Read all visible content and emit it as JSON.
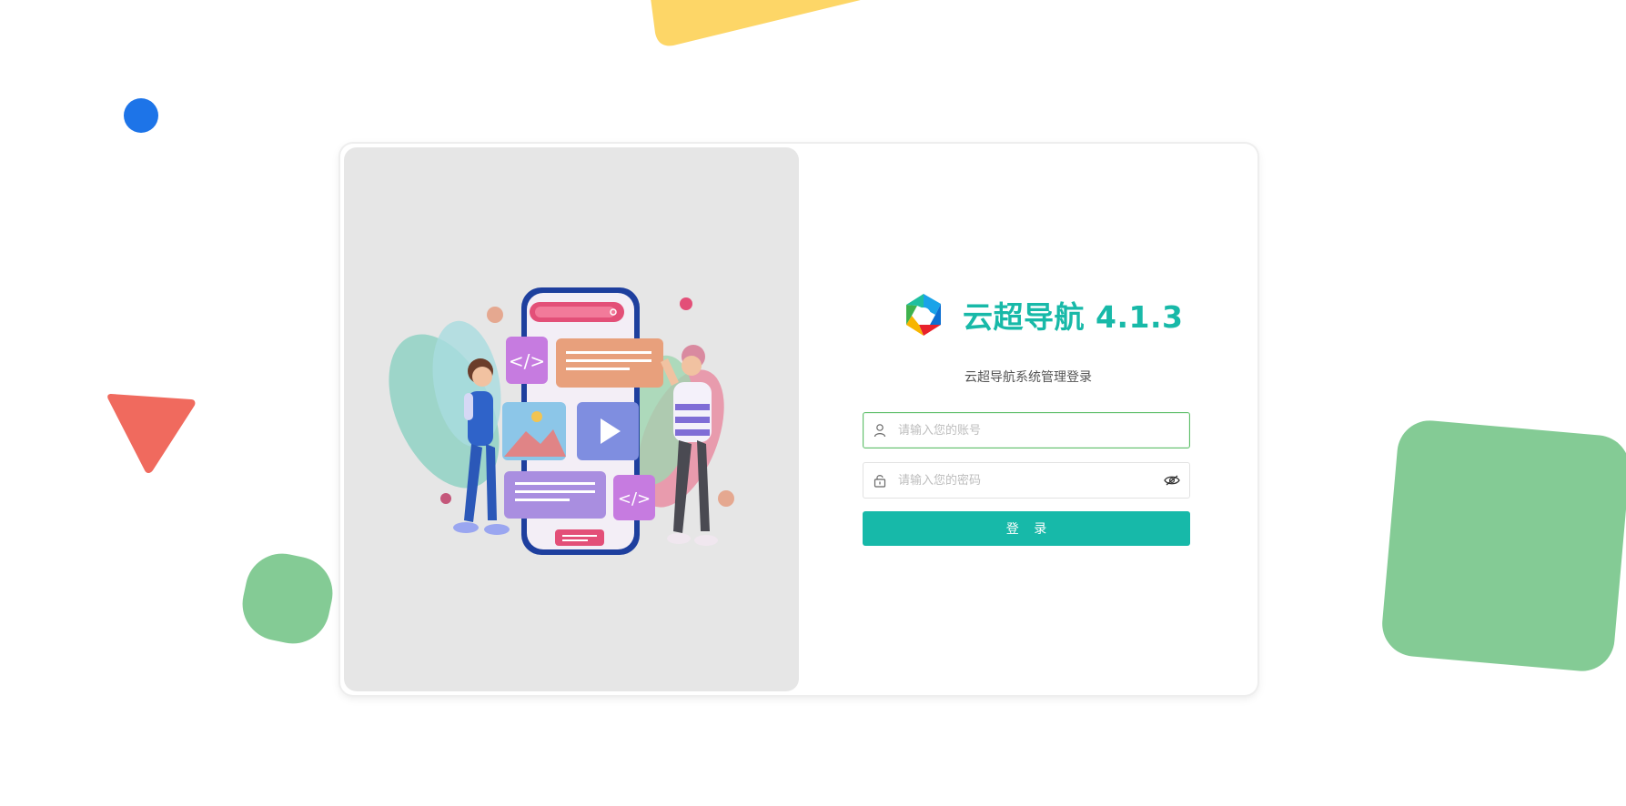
{
  "app": {
    "title": "云超导航 4.1.3",
    "subtitle": "云超导航系统管理登录"
  },
  "login_form": {
    "username_placeholder": "请输入您的账号",
    "username_value": "",
    "password_placeholder": "请输入您的密码",
    "password_value": "",
    "submit_label": "登 录"
  },
  "icons": {
    "brand": "brand-logo-icon",
    "username": "user-icon",
    "password": "lock-icon",
    "toggle_password": "eye-off-icon"
  },
  "colors": {
    "accent": "#17b9a9",
    "title": "#18b9a8",
    "active_border": "#5fbf6a",
    "deco_yellow": "#fdd667",
    "deco_blue": "#1d74e8",
    "deco_red": "#f06a5e",
    "deco_green": "#84cb95",
    "panel_gray": "#e6e6e6"
  }
}
